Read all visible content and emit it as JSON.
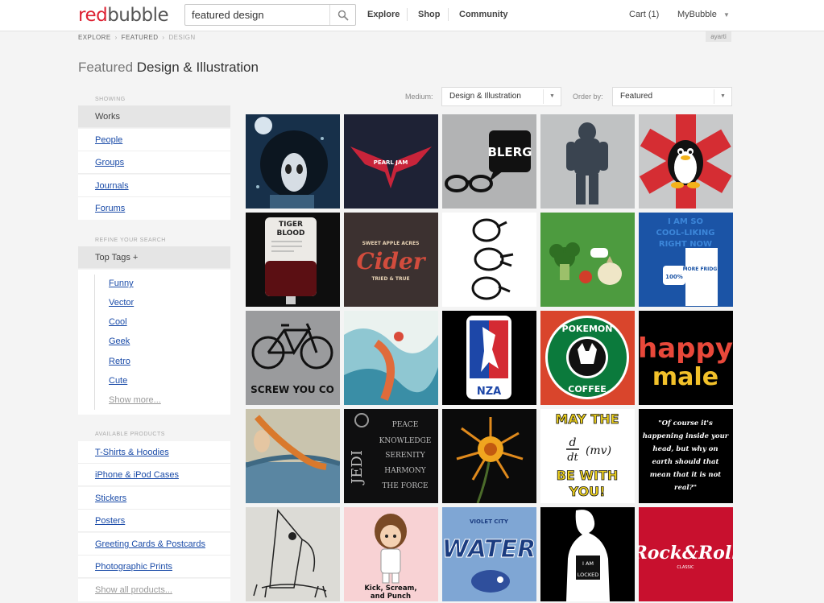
{
  "header": {
    "logo_red": "red",
    "logo_gray": "bubble",
    "search_value": "featured design",
    "nav": [
      "Explore",
      "Shop",
      "Community"
    ],
    "cart": "Cart (1)",
    "account": "MyBubble"
  },
  "breadcrumb": {
    "items": [
      "EXPLORE",
      "FEATURED"
    ],
    "current": "DESIGN"
  },
  "user_tag": "ayarti",
  "title": {
    "light": "Featured",
    "main": "Design & Illustration"
  },
  "sidebar": {
    "showing_label": "SHOWING",
    "showing": [
      "Works",
      "People",
      "Groups",
      "Journals",
      "Forums"
    ],
    "refine_label": "REFINE YOUR SEARCH",
    "top_tags_label": "Top Tags +",
    "tags": [
      "Funny",
      "Vector",
      "Cool",
      "Geek",
      "Retro",
      "Cute"
    ],
    "show_more": "Show more...",
    "products_label": "AVAILABLE PRODUCTS",
    "products": [
      "T-Shirts & Hoodies",
      "iPhone & iPod Cases",
      "Stickers",
      "Posters",
      "Greeting Cards & Postcards",
      "Photographic Prints"
    ],
    "show_all": "Show all products..."
  },
  "filters": {
    "medium_label": "Medium:",
    "medium_value": "Design & Illustration",
    "order_label": "Order by:",
    "order_value": "Featured"
  },
  "artwork_text": {
    "bleeg": "BLERG",
    "pearl": "PEARL JAM",
    "tiger": "TIGER",
    "blood": "BLOOD",
    "cider": "Cider",
    "cider_top": "SWEET APPLE ACRES",
    "cider_bottom": "TRIED & TRUE",
    "cool1": "I AM SO",
    "cool2": "COOL-LIKING",
    "cool3": "RIGHT NOW",
    "fridge_pct": "100%",
    "fridge": "MORE FRIDGE",
    "screw": "SCREW YOU CO",
    "nza": "NZA",
    "pokemon": "POKEMON",
    "coffee": "COFFEE",
    "happy": "happy",
    "male": "male",
    "jedi": "JEDI",
    "jedi_lines": [
      "PEACE",
      "KNOWLEDGE",
      "SERENITY",
      "HARMONY",
      "THE FORCE"
    ],
    "may": "MAY THE",
    "be_with": "BE WITH",
    "you": "YOU!",
    "quote": [
      "\"Of course it's",
      "happening inside your",
      "head, but why on",
      "earth should that",
      "mean that it is not",
      "real?\""
    ],
    "kick": [
      "Kick, Scream,",
      "and Punch"
    ],
    "violet": "VIOLET CITY",
    "water": "WATER",
    "locked": [
      "I AM",
      "LOCKED"
    ],
    "rock": "Rock&Roll",
    "classic": "CLASSIC"
  },
  "colors": {
    "accent": "#d22233",
    "link": "#1a4ba8"
  }
}
